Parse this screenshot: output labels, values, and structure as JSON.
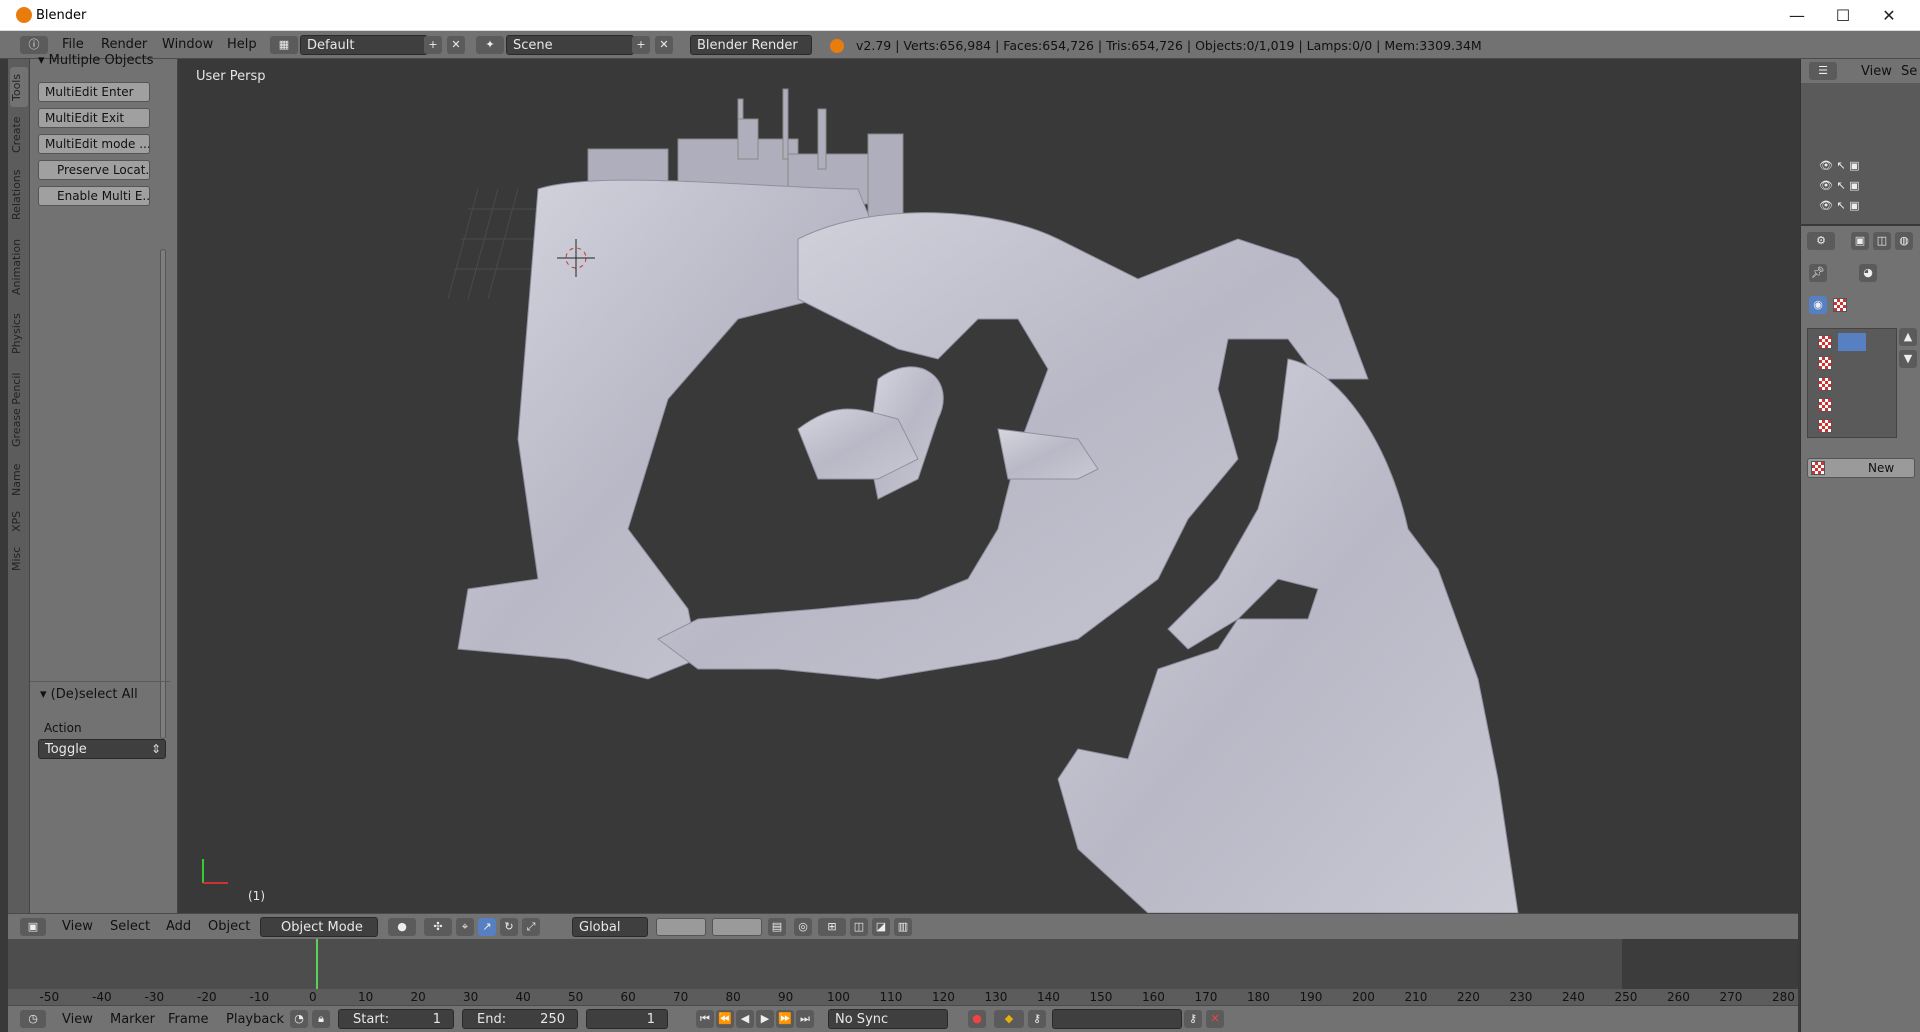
{
  "window": {
    "title": "Blender",
    "minimize": "—",
    "maximize": "☐",
    "close": "✕"
  },
  "infobar": {
    "menus": [
      "File",
      "Render",
      "Window",
      "Help"
    ],
    "screen_layout": "Default",
    "scene": "Scene",
    "render_engine": "Blender Render",
    "stats": "v2.79 | Verts:656,984 | Faces:654,726 | Tris:654,726 | Objects:0/1,019 | Lamps:0/0 | Mem:3309.34M"
  },
  "tool_tabs": [
    "Tools",
    "Create",
    "Relations",
    "Animation",
    "Physics",
    "Grease Pencil",
    "Name",
    "XPS",
    "Misc"
  ],
  "tool_panel": {
    "section_title": "Multiple Objects",
    "buttons": [
      "MultiEdit Enter",
      "MultiEdit Exit",
      "MultiEdit mode ...",
      "Preserve Locat...",
      "Enable Multi E..."
    ],
    "operator_title": "(De)select All",
    "action_label": "Action",
    "action_value": "Toggle"
  },
  "viewport": {
    "label": "User Persp",
    "frame": "(1)"
  },
  "view_header": {
    "menus": [
      "View",
      "Select",
      "Add",
      "Object"
    ],
    "mode": "Object Mode",
    "orientation": "Global"
  },
  "timeline": {
    "ticks": [
      "-50",
      "-40",
      "-30",
      "-20",
      "-10",
      "0",
      "10",
      "20",
      "30",
      "40",
      "50",
      "60",
      "70",
      "80",
      "90",
      "100",
      "110",
      "120",
      "130",
      "140",
      "150",
      "160",
      "170",
      "180",
      "190",
      "200",
      "210",
      "220",
      "230",
      "240",
      "250",
      "260",
      "270",
      "280"
    ],
    "menus": [
      "View",
      "Marker",
      "Frame",
      "Playback"
    ],
    "start_label": "Start:",
    "start_value": "1",
    "end_label": "End:",
    "end_value": "250",
    "current_frame": "1",
    "sync": "No Sync",
    "current_frame_marker": 0
  },
  "outliner": {
    "view_label": "View",
    "search_label": "Se"
  },
  "properties": {
    "new_button": "New"
  },
  "colors": {
    "header": "#727272",
    "viewport": "#393939",
    "mesh": "#c9c9d4",
    "accent": "#e87d0d"
  }
}
